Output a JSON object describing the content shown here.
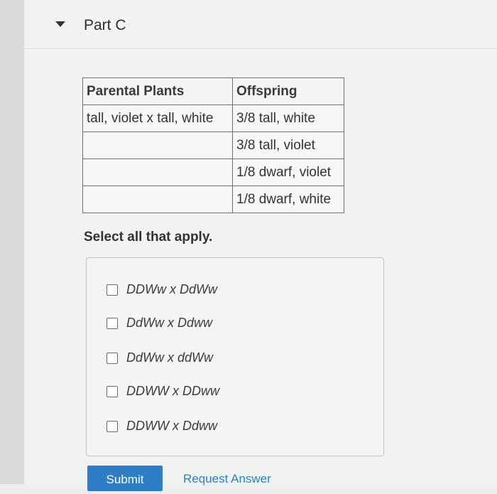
{
  "part": {
    "title": "Part C"
  },
  "table": {
    "headers": [
      "Parental Plants",
      "Offspring"
    ],
    "rows": [
      [
        "tall, violet x tall, white",
        "3/8 tall, white"
      ],
      [
        "",
        "3/8 tall, violet"
      ],
      [
        "",
        "1/8 dwarf, violet"
      ],
      [
        "",
        "1/8 dwarf, white"
      ]
    ]
  },
  "instructions": "Select all that apply.",
  "options": [
    {
      "label": "DDWw x DdWw",
      "checked": false
    },
    {
      "label": "DdWw x Ddww",
      "checked": false
    },
    {
      "label": "DdWw x ddWw",
      "checked": false
    },
    {
      "label": "DDWW x DDww",
      "checked": false
    },
    {
      "label": "DDWW x Ddww",
      "checked": false
    }
  ],
  "actions": {
    "submit_label": "Submit",
    "request_answer_label": "Request Answer"
  }
}
